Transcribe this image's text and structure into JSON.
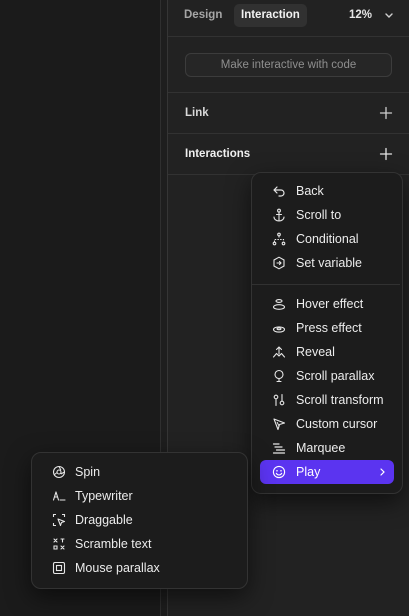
{
  "tabs": {
    "design": "Design",
    "interaction": "Interaction"
  },
  "zoom": "12%",
  "make_interactive": "Make interactive with code",
  "sections": {
    "link": "Link",
    "interactions": "Interactions"
  },
  "menu": {
    "group1": [
      "Back",
      "Scroll to",
      "Conditional",
      "Set variable"
    ],
    "group2": [
      "Hover effect",
      "Press effect",
      "Reveal",
      "Scroll parallax",
      "Scroll transform",
      "Custom cursor",
      "Marquee",
      "Play"
    ],
    "active_item": "Play"
  },
  "submenu": [
    "Spin",
    "Typewriter",
    "Draggable",
    "Scramble text",
    "Mouse parallax"
  ],
  "colors": {
    "accent": "#5b34f0",
    "panel": "#222222",
    "menu": "#1c1c1c"
  }
}
